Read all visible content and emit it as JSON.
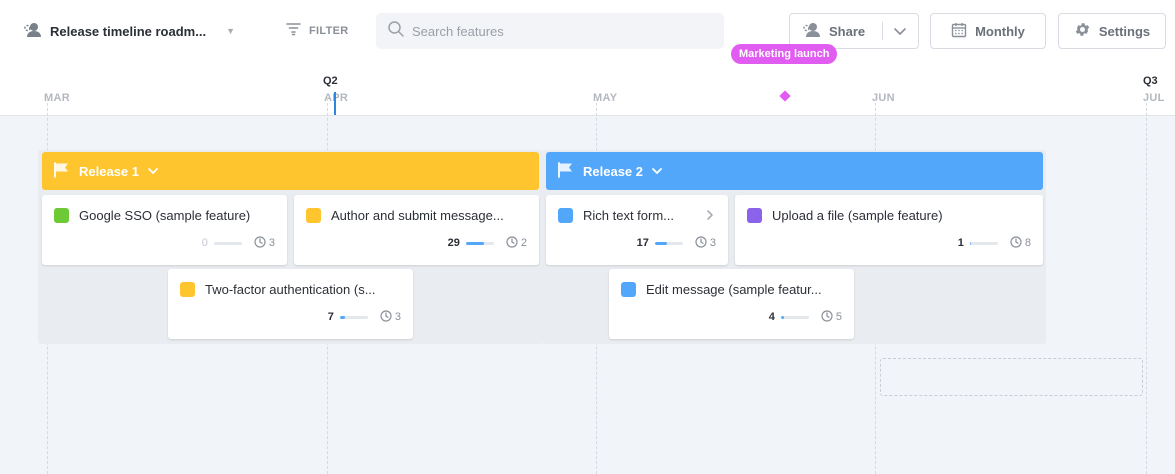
{
  "toolbar": {
    "roadmap_title": "Release timeline roadm...",
    "filter_label": "FILTER",
    "search_placeholder": "Search features",
    "share_label": "Share",
    "monthly_label": "Monthly",
    "settings_label": "Settings"
  },
  "timeline": {
    "months": [
      "MAR",
      "APR",
      "MAY",
      "JUN",
      "JUL"
    ],
    "quarters": [
      "Q2",
      "Q3"
    ],
    "milestone": "Marketing launch"
  },
  "releases": [
    {
      "name": "Release 1",
      "color": "#ffc52f",
      "features": [
        {
          "title": "Google SSO (sample feature)",
          "color": "#6dc935",
          "count": "0",
          "effort": "3",
          "progress": 0
        },
        {
          "title": "Author and submit message...",
          "color": "#ffc52f",
          "count": "29",
          "effort": "2",
          "progress": 0.65
        },
        {
          "title": "Two-factor authentication (s...",
          "color": "#ffc52f",
          "count": "7",
          "effort": "3",
          "progress": 0.2
        }
      ]
    },
    {
      "name": "Release 2",
      "color": "#52a7fb",
      "features": [
        {
          "title": "Rich text form...",
          "color": "#52a7fb",
          "count": "17",
          "effort": "3",
          "progress": 0.45
        },
        {
          "title": "Upload a file (sample feature)",
          "color": "#8a63ea",
          "count": "1",
          "effort": "8",
          "progress": 0.05
        },
        {
          "title": "Edit message (sample featur...",
          "color": "#52a7fb",
          "count": "4",
          "effort": "5",
          "progress": 0.1
        }
      ]
    }
  ],
  "icons": {
    "roadmap": "users-icon",
    "filter": "filter-icon",
    "search": "search-icon",
    "share": "users-icon",
    "monthly": "calendar-icon",
    "settings": "gear-icon",
    "release": "flag-icon",
    "effort": "clock-icon"
  }
}
